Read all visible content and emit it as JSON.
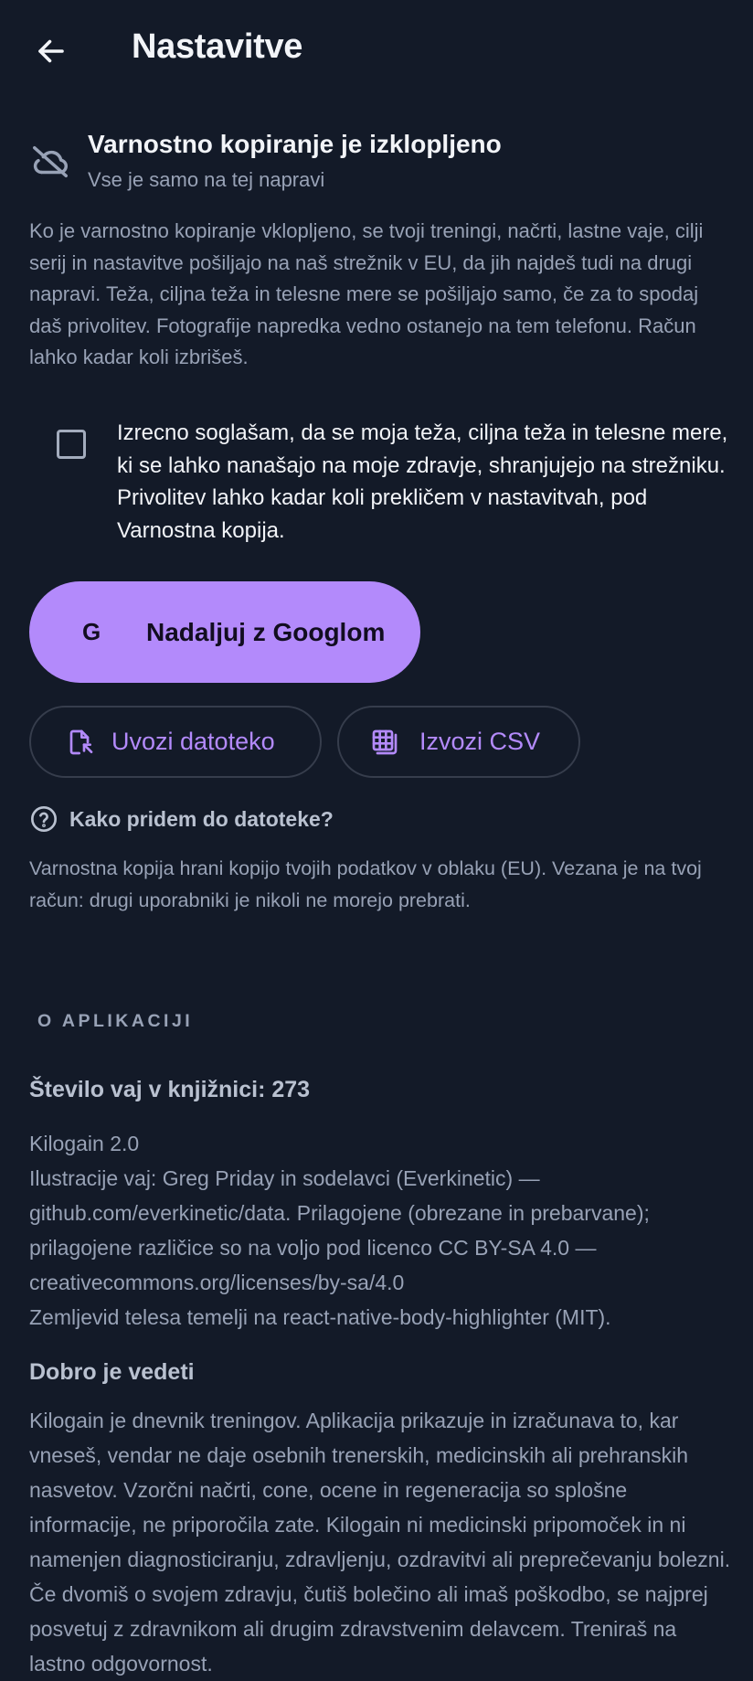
{
  "header": {
    "title": "Nastavitve",
    "back_icon": "arrow-left-icon"
  },
  "backup": {
    "status_icon": "cloud-off-icon",
    "status_title": "Varnostno kopiranje je izklopljeno",
    "status_subtitle": "Vse je samo na tej napravi",
    "description": "Ko je varnostno kopiranje vklopljeno, se tvoji treningi, načrti, lastne vaje, cilji serij in nastavitve pošiljajo na naš strežnik v EU, da jih najdeš tudi na drugi napravi. Teža, ciljna teža in telesne mere se pošiljajo samo, če za to spodaj daš privolitev. Fotografije napredka vedno ostanejo na tem telefonu. Račun lahko kadar koli izbrišeš.",
    "consent_checked": false,
    "consent_text": "Izrecno soglašam, da se moja teža, ciljna teža in telesne mere, ki se lahko nanašajo na moje zdravje, shranjujejo na strežniku. Privolitev lahko kadar koli prekličem v nastavitvah, pod Varnostna kopija.",
    "google_glyph": "G",
    "google_label": "Nadaljuj z Googlom",
    "import_label": "Uvozi datoteko",
    "import_icon": "file-import-icon",
    "export_label": "Izvozi CSV",
    "export_icon": "spreadsheet-icon",
    "help_icon": "help-circle-icon",
    "help_label": "Kako pridem do datoteke?",
    "note": "Varnostna kopija hrani kopijo tvojih podatkov v oblaku (EU). Vezana je na tvoj račun: drugi uporabniki je nikoli ne morejo prebrati."
  },
  "about": {
    "section_label": "O APLIKACIJI",
    "exercise_count": "Število vaj v knjižnici: 273",
    "lines": [
      "Kilogain 2.0",
      "Ilustracije vaj: Greg Priday in sodelavci (Everkinetic) — github.com/everkinetic/data. Prilagojene (obrezane in prebarvane); prilagojene različice so na voljo pod licenco CC BY-SA 4.0 — creativecommons.org/licenses/by-sa/4.0",
      "Zemljevid telesa temelji na react-native-body-highlighter (MIT)."
    ],
    "good_to_know_title": "Dobro je vedeti",
    "good_to_know_text": "Kilogain je dnevnik treningov. Aplikacija prikazuje in izračunava to, kar vneseš, vendar ne daje osebnih trenerskih, medicinskih ali prehranskih nasvetov. Vzorčni načrti, cone, ocene in regeneracija so splošne informacije, ne priporočila zate. Kilogain ni medicinski pripomoček in ni namenjen diagnosticiranju, zdravljenju, ozdravitvi ali preprečevanju bolezni. Če dvomiš o svojem zdravju, čutiš bolečino ali imaš poškodbo, se najprej posvetuj z zdravnikom ali drugim zdravstvenim delavcem. Treniraš na lastno odgovornost."
  },
  "colors": {
    "background": "#131a28",
    "accent": "#b38afb",
    "text_primary": "#f2f4f8",
    "text_secondary": "#98a2b6"
  }
}
